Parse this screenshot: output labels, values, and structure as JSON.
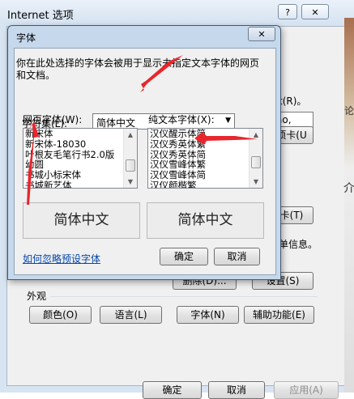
{
  "outer": {
    "title": "Internet 选项",
    "help_icon": "?",
    "close_icon": "✕",
    "partial_right_1": "t(R)。",
    "partial_right_2": "ao,",
    "partial_right_3": "项卡(U",
    "partial_right_4": "卡(T)",
    "partial_right_5": "单信息。",
    "delete_button": "删除(D)...",
    "settings_button": "设置(S)",
    "appearance_label": "外观",
    "colors_button": "颜色(O)",
    "languages_button": "语言(L)",
    "fonts_button": "字体(N)",
    "accessibility_button": "辅助功能(E)",
    "ok_button": "确定",
    "cancel_button": "取消",
    "apply_button": "应用(A)",
    "edge_text_1": "论",
    "edge_text_2": "介"
  },
  "dialog": {
    "title": "字体",
    "close_icon": "✕",
    "description": "你在此处选择的字体会被用于显示未指定文本字体的网页和文档。",
    "charset_label": "字符集(L):",
    "charset_value": "简体中文",
    "webpage_font_label": "网页字体(W):",
    "plaintext_font_label": "纯文本字体(X):",
    "webpage_fonts": [
      "新宋体",
      "新宋体-18030",
      "叶根友毛笔行书2.0版",
      "幼圆",
      "书城小标宋体",
      "书城新艺体"
    ],
    "plaintext_fonts": [
      "汉仪醒示体简",
      "汉仪秀英体繁",
      "汉仪秀英体简",
      "汉仪雪峰体繁",
      "汉仪雪峰体简",
      "汉仪颜楷繁"
    ],
    "webpage_preview": "简体中文",
    "plaintext_preview": "简体中文",
    "ignore_link": "如何忽略预设字体",
    "ok_button": "确定",
    "cancel_button": "取消"
  },
  "colors": {
    "annotation_arrow": "#e8262c",
    "link": "#0645ad"
  }
}
